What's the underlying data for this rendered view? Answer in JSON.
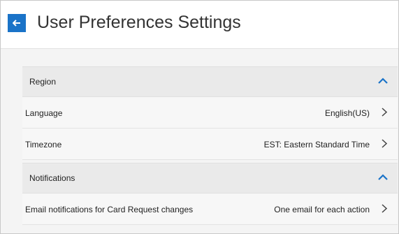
{
  "header": {
    "title": "User Preferences Settings",
    "back_icon": "arrow-left-icon",
    "accent_color": "#1a73c8"
  },
  "sections": [
    {
      "title": "Region",
      "expanded": true,
      "rows": [
        {
          "label": "Language",
          "value": "English(US)"
        },
        {
          "label": "Timezone",
          "value": "EST: Eastern Standard Time"
        }
      ]
    },
    {
      "title": "Notifications",
      "expanded": true,
      "rows": [
        {
          "label": "Email notifications for Card Request changes",
          "value": "One email for each action"
        }
      ]
    }
  ]
}
